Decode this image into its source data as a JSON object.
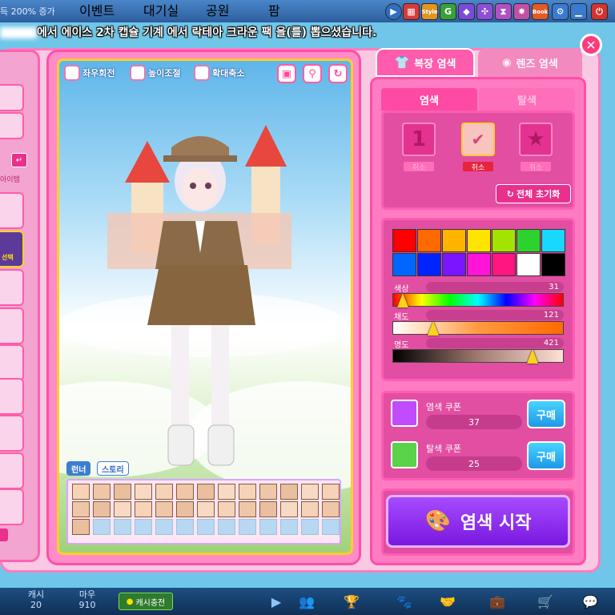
{
  "topbar": {
    "exp_text": "득 200% 증가",
    "menus": [
      "이벤트",
      "대기실",
      "공원",
      "팜"
    ],
    "icons": [
      "play-icon",
      "store-icon",
      "style-icon",
      "g-icon",
      "cube-icon",
      "puzzle-icon",
      "hourglass-icon",
      "star-icon",
      "book-icon",
      "gear-icon",
      "minimize-icon",
      "power-icon"
    ],
    "icon_labels": {
      "style": "Style",
      "g": "G",
      "book": "Book"
    }
  },
  "notice": "에서 에이스 2차 캡슐 기계 에서 락테아 크라운 팩 을(를) 뽑으셨습니다.",
  "left_panel": {
    "item_label": "아이템",
    "select_label": "선택"
  },
  "character_panel": {
    "tools": [
      {
        "label": "좌우회전",
        "icon": "rotate-lr-icon"
      },
      {
        "label": "높이조절",
        "icon": "height-icon"
      },
      {
        "label": "확대축소",
        "icon": "zoom-icon"
      }
    ],
    "round_buttons": [
      "photo-icon",
      "walk-icon",
      "refresh-icon"
    ],
    "tabs": [
      "런너",
      "스토리"
    ]
  },
  "dye_panel": {
    "tabs": [
      {
        "label": "복장 염색",
        "icon": "shirt-icon",
        "active": true
      },
      {
        "label": "렌즈 염색",
        "icon": "eye-icon",
        "active": false
      }
    ],
    "subtabs": [
      {
        "label": "염색",
        "active": true
      },
      {
        "label": "탈색",
        "active": false
      }
    ],
    "slots": [
      {
        "symbol": "1",
        "label": "취소"
      },
      {
        "symbol": "✔",
        "label": "취소"
      },
      {
        "symbol": "★",
        "label": "취소"
      }
    ],
    "reset_label": "전체 초기화",
    "palette": [
      "#ff0000",
      "#ff6a00",
      "#ffb400",
      "#ffe400",
      "#a2e400",
      "#2cd32c",
      "#18d8ff",
      "#0066ff",
      "#0024ff",
      "#7a16ff",
      "#ff14d8",
      "#ff1680",
      "#ffffff",
      "#000000"
    ],
    "sliders": [
      {
        "label": "색상",
        "value": "31",
        "fraction": 0.06
      },
      {
        "label": "채도",
        "value": "121",
        "fraction": 0.24
      },
      {
        "label": "명도",
        "value": "421",
        "fraction": 0.82
      }
    ],
    "coupons": [
      {
        "name": "염색 쿠폰",
        "count": "37",
        "buy": "구매",
        "color": "#c04bff"
      },
      {
        "name": "탈색 쿠폰",
        "count": "25",
        "buy": "구매",
        "color": "#5ad24a"
      }
    ],
    "start_label": "염색 시작"
  },
  "bottombar": {
    "cash_label": "캐시",
    "cash_value": "20",
    "mau_label": "마우",
    "mau_value": "910",
    "charge_label": "캐시충전",
    "icons": [
      "play-icon",
      "friends-icon",
      "trophy-icon",
      "paw-icon",
      "handshake-icon",
      "bag-icon",
      "cart-icon",
      "chat-icon"
    ]
  }
}
